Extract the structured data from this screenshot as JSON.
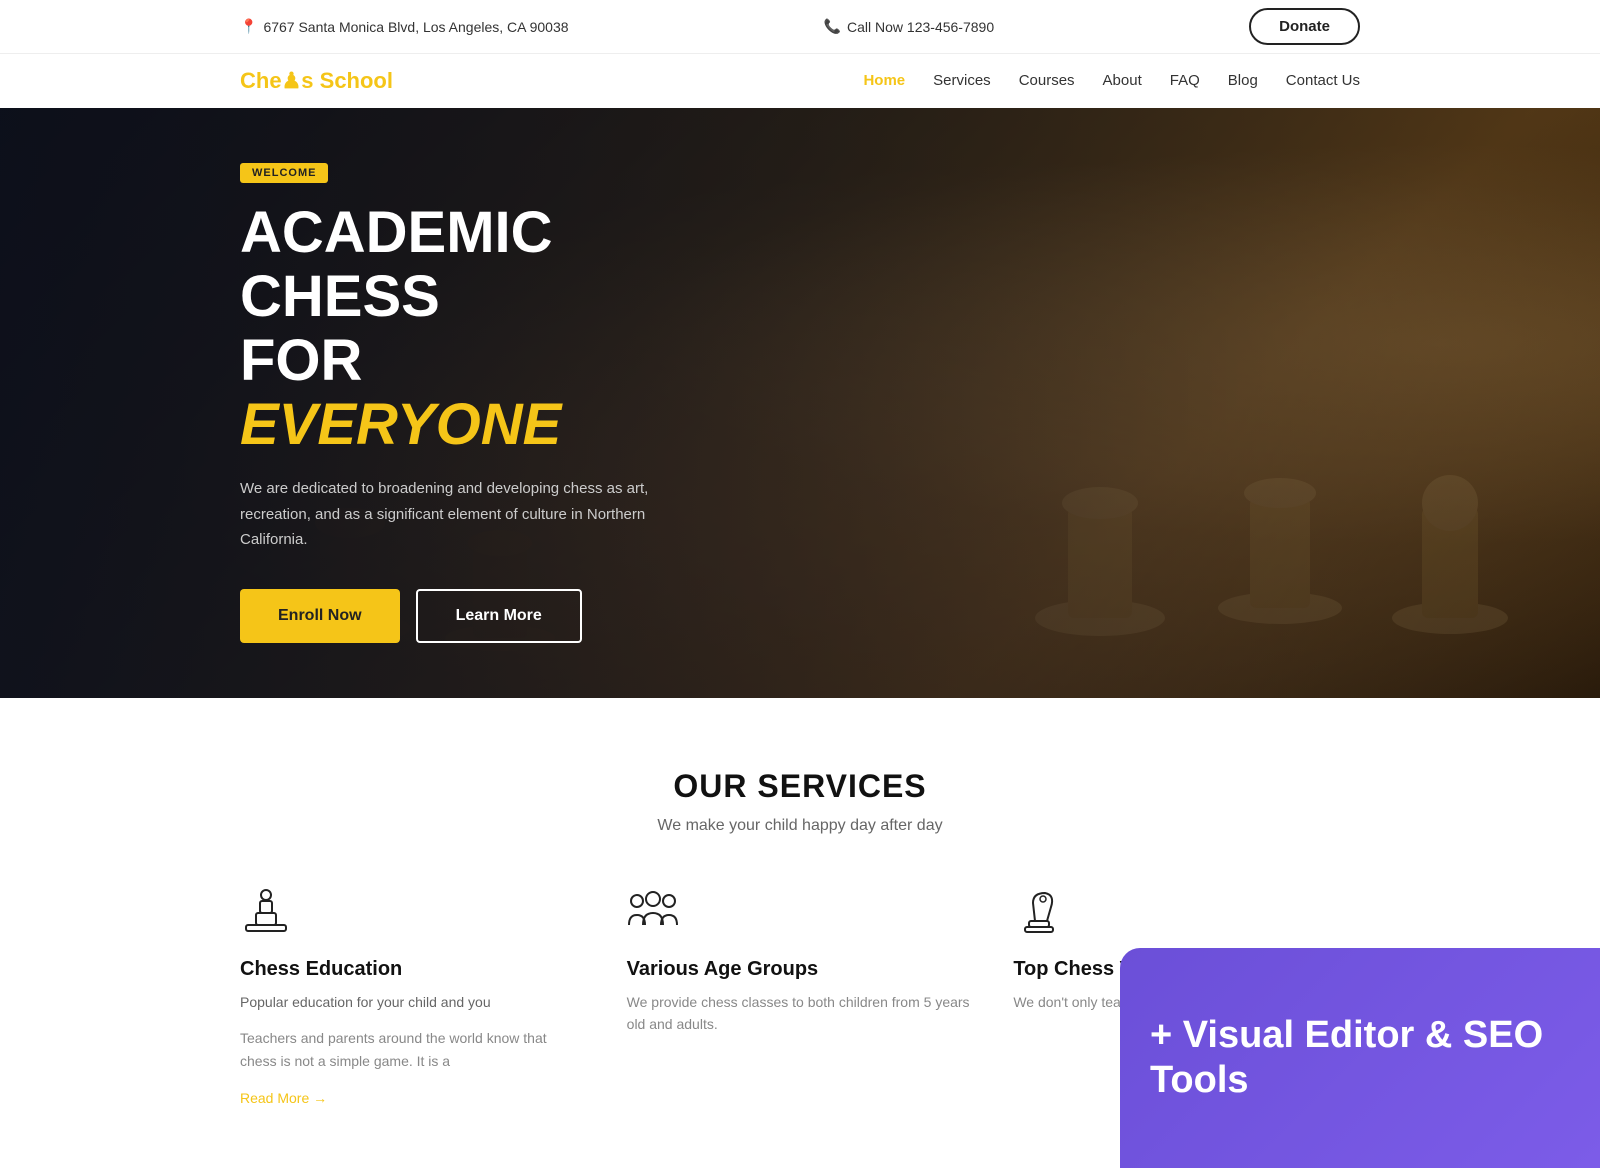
{
  "topbar": {
    "address": "6767 Santa Monica Blvd, Los Angeles, CA 90038",
    "phone_label": "Call Now 123-456-7890",
    "donate_label": "Donate"
  },
  "navbar": {
    "logo_text1": "Che",
    "logo_chess": "s",
    "logo_text2": " School",
    "nav_items": [
      {
        "label": "Home",
        "active": true
      },
      {
        "label": "Services",
        "active": false
      },
      {
        "label": "Courses",
        "active": false
      },
      {
        "label": "About",
        "active": false
      },
      {
        "label": "FAQ",
        "active": false
      },
      {
        "label": "Blog",
        "active": false
      },
      {
        "label": "Contact Us",
        "active": false
      }
    ]
  },
  "hero": {
    "badge": "WELCOME",
    "title_line1": "ACADEMIC CHESS",
    "title_line2_normal": "FOR ",
    "title_line2_highlight": "EVERYONE",
    "description": "We are dedicated to broadening and developing chess as art, recreation, and as a significant element of culture in Northern California.",
    "enroll_label": "Enroll Now",
    "learn_label": "Learn More"
  },
  "services": {
    "heading": "OUR SERVICES",
    "subheading": "We make your child happy day after day",
    "items": [
      {
        "title": "Chess Education",
        "subtitle": "Popular education for your child and you",
        "description": "Teachers and parents around the world know that chess is not a simple game. It is a"
      },
      {
        "title": "Various Age Groups",
        "subtitle": "",
        "description": "We provide chess classes to both children from 5 years old and adults."
      },
      {
        "title": "Top Chess Va",
        "subtitle": "",
        "description": "We don't only teach also other top varia"
      }
    ]
  },
  "visual_editor": {
    "text": "+ Visual Editor & SEO Tools"
  }
}
